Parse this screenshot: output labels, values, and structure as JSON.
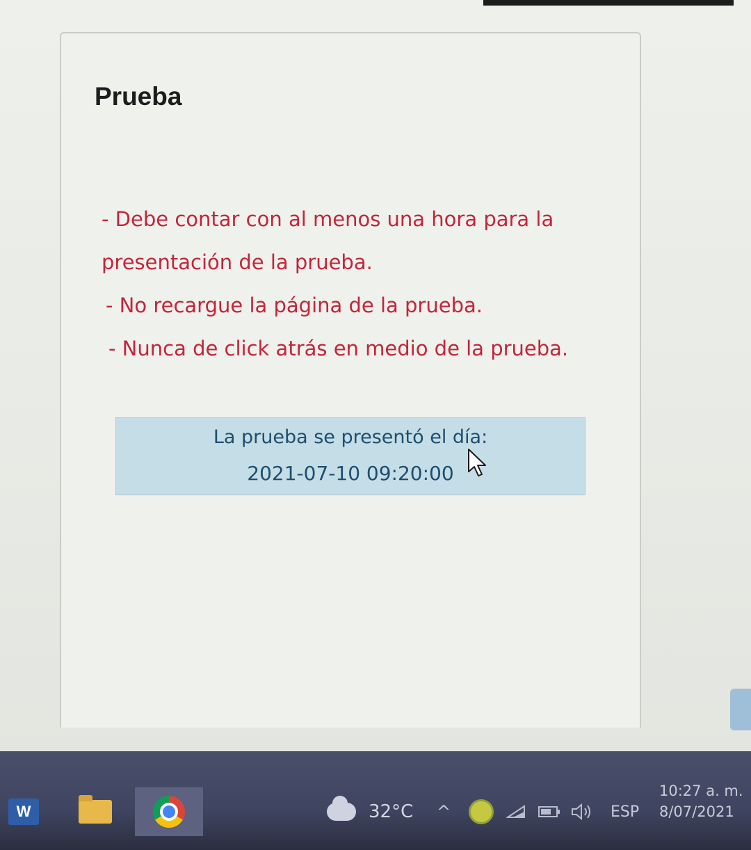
{
  "card": {
    "title": "Prueba",
    "notes": [
      "- Debe contar con al menos una hora para la",
      "presentación de la prueba.",
      "- No recargue la página de la prueba.",
      "- Nunca de click atrás en medio de la prueba."
    ],
    "info": {
      "label": "La prueba se presentó el día:",
      "datetime": "2021-07-10 09:20:00"
    }
  },
  "taskbar": {
    "apps": [
      {
        "name": "word-icon",
        "label": "W"
      },
      {
        "name": "folder-icon"
      },
      {
        "name": "chrome-icon",
        "active": true
      }
    ],
    "weather": {
      "icon": "cloud-icon",
      "temperature": "32°C"
    },
    "tray": {
      "chevron": "^",
      "language": "ESP"
    },
    "clock": {
      "time": "10:27 a. m.",
      "date": "8/07/2021"
    }
  },
  "colors": {
    "notes_text": "#c3253a",
    "info_bg": "#c5dde6",
    "info_text": "#1d4e6f",
    "taskbar_bg": "#3f4560"
  }
}
